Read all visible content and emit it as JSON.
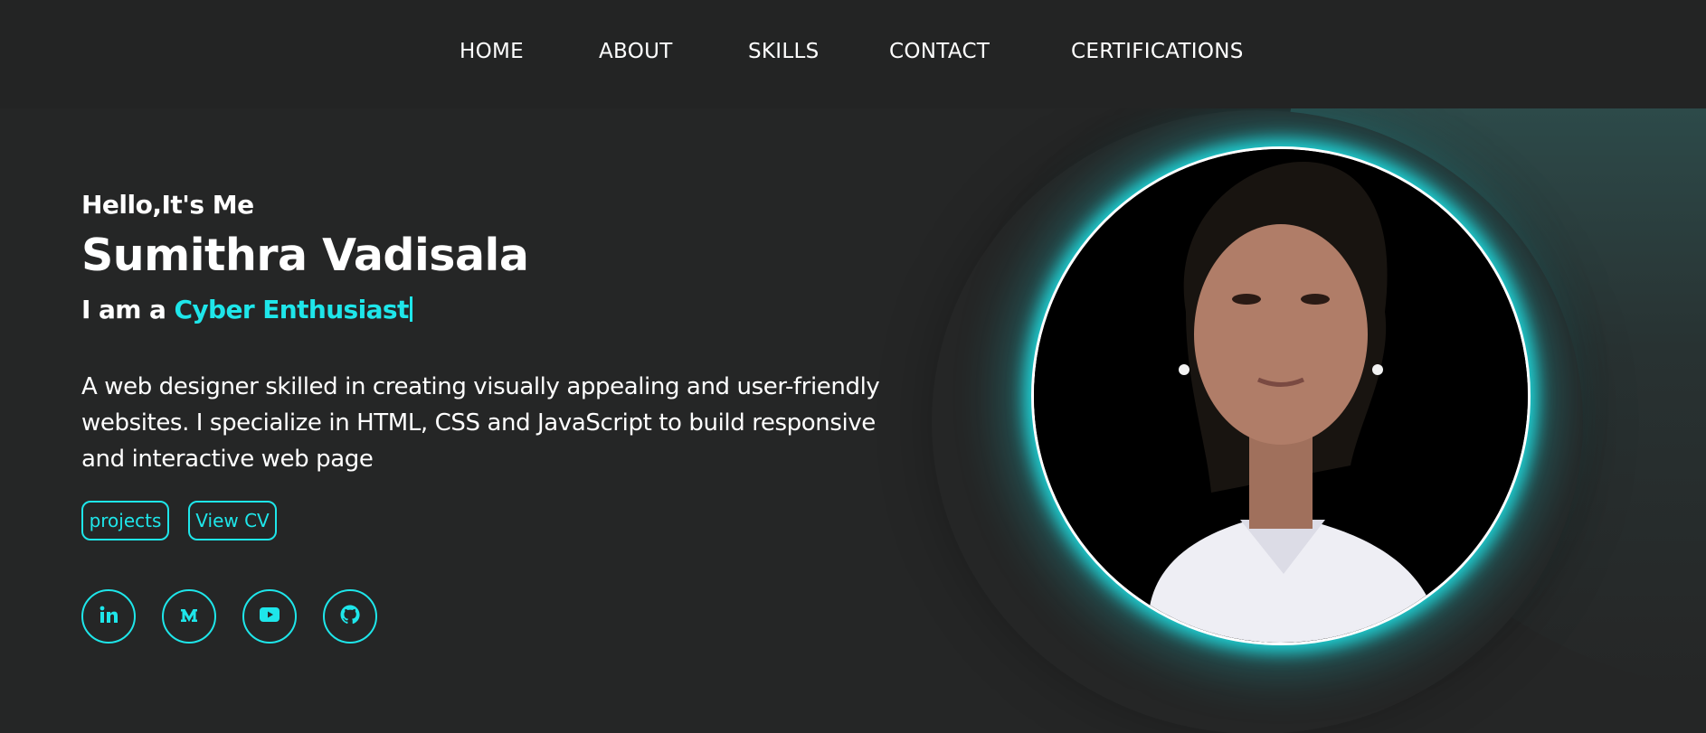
{
  "nav": {
    "items": [
      {
        "label": "HOME"
      },
      {
        "label": "ABOUT"
      },
      {
        "label": "SKILLS"
      },
      {
        "label": "CONTACT"
      },
      {
        "label": "CERTIFICATIONS"
      }
    ]
  },
  "hero": {
    "greeting": "Hello,It's Me",
    "name": "Sumithra Vadisala",
    "role_prefix": "I am a ",
    "role_accent": "Cyber Enthusiast",
    "description": "A web designer skilled in creating visually appealing and user-friendly websites. I specialize in HTML, CSS and JavaScript to build responsive and interactive web page",
    "buttons": {
      "projects": "projects",
      "view_cv": "View CV"
    },
    "social_icons": [
      "linkedin-icon",
      "medium-icon",
      "youtube-icon",
      "github-icon"
    ]
  },
  "colors": {
    "accent": "#1ee6ea",
    "background": "#252626",
    "navbar": "#232424",
    "text": "#ffffff",
    "teal_shape": "#3c7270"
  }
}
